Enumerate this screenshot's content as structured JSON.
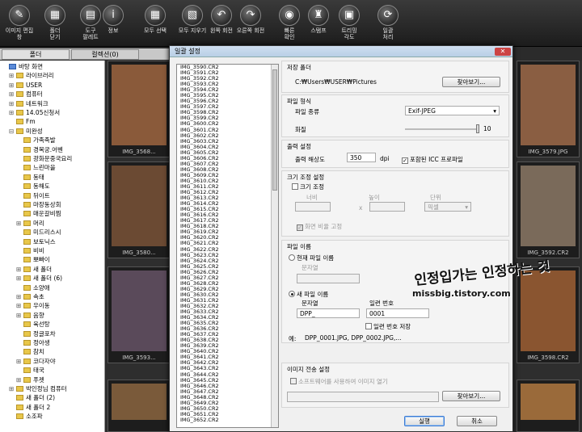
{
  "toolbar": {
    "items": [
      {
        "label1": "이미지 편집",
        "label2": "창",
        "icon": "edit-image-icon",
        "glyph": "✎"
      },
      {
        "label1": "폴더",
        "label2": "닫기",
        "icon": "folder-icon",
        "glyph": "▦"
      },
      {
        "label1": "도구",
        "label2": "팔레트",
        "icon": "palette-icon",
        "glyph": "▤"
      },
      {
        "label1": "정보",
        "label2": "",
        "icon": "info-icon",
        "glyph": "i"
      },
      {
        "label1": "모두 선택",
        "label2": "",
        "icon": "select-all-icon",
        "glyph": "▦"
      },
      {
        "label1": "모두 지우기",
        "label2": "",
        "icon": "clear-all-icon",
        "glyph": "▧"
      },
      {
        "label1": "왼쪽 회전",
        "label2": "",
        "icon": "rotate-left-icon",
        "glyph": "↶"
      },
      {
        "label1": "오른쪽 회전",
        "label2": "",
        "icon": "rotate-right-icon",
        "glyph": "↷"
      },
      {
        "label1": "빠른",
        "label2": "확인",
        "icon": "quick-check-icon",
        "glyph": "◉"
      },
      {
        "label1": "스탬프",
        "label2": "",
        "icon": "stamp-icon",
        "glyph": "♜"
      },
      {
        "label1": "트리밍",
        "label2": "각도",
        "icon": "trim-icon",
        "glyph": "▣"
      },
      {
        "label1": "일괄",
        "label2": "처리",
        "icon": "batch-icon",
        "glyph": "⟳"
      }
    ]
  },
  "tabs": [
    "폴더",
    "컬렉션(0)"
  ],
  "tree": [
    {
      "label": "바탕 화면",
      "indent": 0,
      "exp": ""
    },
    {
      "label": "라이브러리",
      "indent": 1,
      "exp": "⊞"
    },
    {
      "label": "USER",
      "indent": 1,
      "exp": "⊞"
    },
    {
      "label": "컴퓨터",
      "indent": 1,
      "exp": "⊞"
    },
    {
      "label": "네트워크",
      "indent": 1,
      "exp": "⊞"
    },
    {
      "label": "14.05신청서",
      "indent": 1,
      "exp": "⊞"
    },
    {
      "label": "Fm",
      "indent": 1,
      "exp": ""
    },
    {
      "label": "미완성",
      "indent": 1,
      "exp": "⊟"
    },
    {
      "label": "가족족발",
      "indent": 2,
      "exp": ""
    },
    {
      "label": "경복궁.어벤",
      "indent": 2,
      "exp": ""
    },
    {
      "label": "광화문중국요리",
      "indent": 2,
      "exp": ""
    },
    {
      "label": "느린마을",
      "indent": 2,
      "exp": ""
    },
    {
      "label": "동태",
      "indent": 2,
      "exp": ""
    },
    {
      "label": "동해도",
      "indent": 2,
      "exp": ""
    },
    {
      "label": "뒤이트",
      "indent": 2,
      "exp": ""
    },
    {
      "label": "마장동상회",
      "indent": 2,
      "exp": ""
    },
    {
      "label": "매운갈비찜",
      "indent": 2,
      "exp": ""
    },
    {
      "label": "머리",
      "indent": 2,
      "exp": "⊞"
    },
    {
      "label": "미드리스시",
      "indent": 2,
      "exp": ""
    },
    {
      "label": "보토닉스",
      "indent": 2,
      "exp": ""
    },
    {
      "label": "비비",
      "indent": 2,
      "exp": ""
    },
    {
      "label": "뽀빠이",
      "indent": 2,
      "exp": ""
    },
    {
      "label": "새 폴더",
      "indent": 2,
      "exp": "⊞"
    },
    {
      "label": "새 폴더 (6)",
      "indent": 2,
      "exp": "⊞"
    },
    {
      "label": "소양애",
      "indent": 2,
      "exp": ""
    },
    {
      "label": "속초",
      "indent": 2,
      "exp": "⊞"
    },
    {
      "label": "우이동",
      "indent": 2,
      "exp": "⊞"
    },
    {
      "label": "음향",
      "indent": 2,
      "exp": "⊞"
    },
    {
      "label": "육선탕",
      "indent": 2,
      "exp": ""
    },
    {
      "label": "정글포차",
      "indent": 2,
      "exp": ""
    },
    {
      "label": "정아생",
      "indent": 2,
      "exp": ""
    },
    {
      "label": "참치",
      "indent": 2,
      "exp": ""
    },
    {
      "label": "코다자야",
      "indent": 2,
      "exp": "⊞"
    },
    {
      "label": "태국",
      "indent": 2,
      "exp": ""
    },
    {
      "label": "푸켓",
      "indent": 2,
      "exp": "⊞"
    },
    {
      "label": "박인정님 컴퓨터",
      "indent": 1,
      "exp": "⊞"
    },
    {
      "label": "새 폴더 (2)",
      "indent": 1,
      "exp": ""
    },
    {
      "label": "새 폴더 2",
      "indent": 1,
      "exp": ""
    },
    {
      "label": "소조파",
      "indent": 1,
      "exp": ""
    }
  ],
  "thumbs": [
    {
      "cap": "IMG_3568...",
      "color": "#8a5a3a"
    },
    {
      "cap": "IMG_3579.JPG",
      "color": "#8a5e42"
    },
    {
      "cap": "IMG_3580...",
      "color": "#6b4a33"
    },
    {
      "cap": "IMG_3592.CR2",
      "color": "#7a6a5a"
    },
    {
      "cap": "IMG_3593...",
      "color": "#5a4a5a"
    },
    {
      "cap": "IMG_3598.CR2",
      "color": "#8a5530"
    },
    {
      "cap": "",
      "color": "#7a5a3a"
    },
    {
      "cap": "",
      "color": "#9a6a3a"
    }
  ],
  "dialog": {
    "title": "일괄 설정",
    "files": [
      "IMG_3590.CR2",
      "IMG_3591.CR2",
      "IMG_3592.CR2",
      "IMG_3593.CR2",
      "IMG_3594.CR2",
      "IMG_3595.CR2",
      "IMG_3596.CR2",
      "IMG_3597.CR2",
      "IMG_3598.CR2",
      "IMG_3599.CR2",
      "IMG_3600.CR2",
      "IMG_3601.CR2",
      "IMG_3602.CR2",
      "IMG_3603.CR2",
      "IMG_3604.CR2",
      "IMG_3605.CR2",
      "IMG_3606.CR2",
      "IMG_3607.CR2",
      "IMG_3608.CR2",
      "IMG_3609.CR2",
      "IMG_3610.CR2",
      "IMG_3611.CR2",
      "IMG_3612.CR2",
      "IMG_3613.CR2",
      "IMG_3614.CR2",
      "IMG_3615.CR2",
      "IMG_3616.CR2",
      "IMG_3617.CR2",
      "IMG_3618.CR2",
      "IMG_3619.CR2",
      "IMG_3620.CR2",
      "IMG_3621.CR2",
      "IMG_3622.CR2",
      "IMG_3623.CR2",
      "IMG_3624.CR2",
      "IMG_3625.CR2",
      "IMG_3626.CR2",
      "IMG_3627.CR2",
      "IMG_3628.CR2",
      "IMG_3629.CR2",
      "IMG_3630.CR2",
      "IMG_3631.CR2",
      "IMG_3632.CR2",
      "IMG_3633.CR2",
      "IMG_3634.CR2",
      "IMG_3635.CR2",
      "IMG_3636.CR2",
      "IMG_3637.CR2",
      "IMG_3638.CR2",
      "IMG_3639.CR2",
      "IMG_3640.CR2",
      "IMG_3641.CR2",
      "IMG_3642.CR2",
      "IMG_3643.CR2",
      "IMG_3644.CR2",
      "IMG_3645.CR2",
      "IMG_3646.CR2",
      "IMG_3647.CR2",
      "IMG_3648.CR2",
      "IMG_3649.CR2",
      "IMG_3650.CR2",
      "IMG_3651.CR2",
      "IMG_3652.CR2"
    ],
    "save_folder": {
      "title": "저장 폴더",
      "path": "C:₩Users₩USER₩Pictures",
      "browse": "찾아보기..."
    },
    "file_format": {
      "title": "파일 형식",
      "type_label": "파일 종류",
      "type_value": "Exif-JPEG",
      "quality_label": "화질",
      "quality_value": "10"
    },
    "output": {
      "title": "출력 설정",
      "res_label": "출력 해상도",
      "res_value": "350",
      "res_unit": "dpi",
      "icc_label": "포함된 ICC 프로파일",
      "icc_checked": "✓"
    },
    "resize": {
      "title": "크기 조정 설정",
      "check_label": "크기 조정",
      "width_label": "너비",
      "height_label": "높이",
      "unit_label": "단위",
      "unit_value": "픽셀",
      "times": "x",
      "aspect_label": "화면 비율 고정",
      "aspect_checked": "✓"
    },
    "filename": {
      "title": "파일 이름",
      "current_label": "현재 파일 이름",
      "current_sub": "문자열",
      "new_label": "새 파일 이름",
      "string_label": "문자열",
      "string_value": "DPP_",
      "serial_label": "일련 번호",
      "serial_value": "0001",
      "serial_save_label": "일련 번호 저장",
      "example_label": "예:",
      "example_value": "DPP_0001.JPG, DPP_0002.JPG,..."
    },
    "transfer": {
      "title": "이미지 전송 설정",
      "check_label": "소프트웨어를 사용하여 이미지 열기",
      "browse": "찾아보기..."
    },
    "run": "실행",
    "cancel": "취소"
  },
  "watermark": {
    "line1": "인정입가는 인정하는 것",
    "line2": "missbig.tistory.com"
  }
}
